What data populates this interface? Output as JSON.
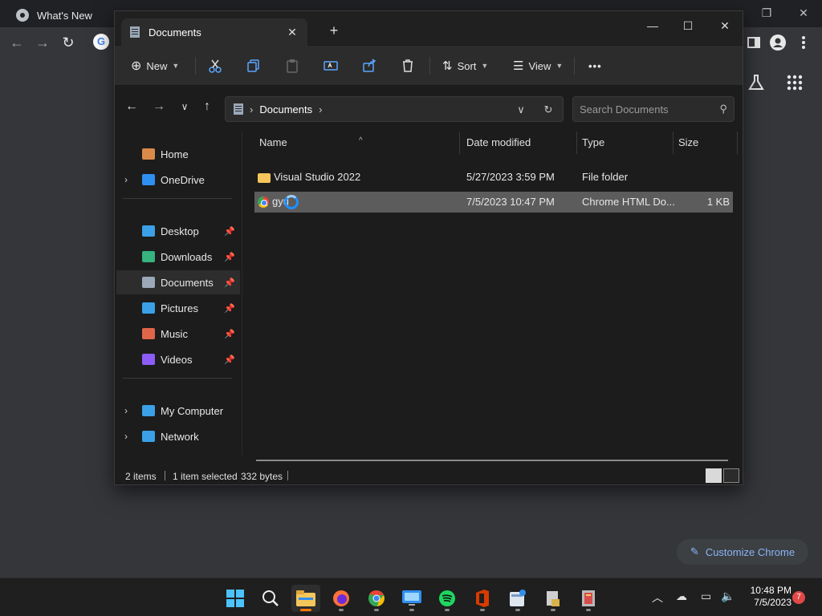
{
  "chrome": {
    "tab_title": "What's New",
    "customize_label": "Customize Chrome"
  },
  "window": {
    "tab_title": "Documents",
    "new_tab_symbol": "+",
    "close_tab_symbol": "✕",
    "minimize_symbol": "—",
    "maximize_symbol": "☐",
    "close_symbol": "✕"
  },
  "toolbar": {
    "new_label": "New",
    "sort_label": "Sort",
    "view_label": "View",
    "more_label": "•••",
    "icons": [
      "cut-icon",
      "copy-icon",
      "paste-icon",
      "rename-icon",
      "share-icon",
      "delete-icon"
    ]
  },
  "address": {
    "crumb": "Documents",
    "search_placeholder": "Search Documents"
  },
  "sidebar": {
    "items": [
      {
        "label": "Home",
        "icon": "home-icon",
        "expandable": false,
        "pinned": false,
        "color": "#d98a4a"
      },
      {
        "label": "OneDrive",
        "icon": "onedrive-icon",
        "expandable": true,
        "pinned": false,
        "color": "#2f8ff0"
      },
      {
        "label": "Desktop",
        "icon": "desktop-icon",
        "expandable": false,
        "pinned": true,
        "color": "#3ba0e6"
      },
      {
        "label": "Downloads",
        "icon": "downloads-icon",
        "expandable": false,
        "pinned": true,
        "color": "#36b37e"
      },
      {
        "label": "Documents",
        "icon": "documents-icon",
        "expandable": false,
        "pinned": true,
        "color": "#9aa8b8",
        "selected": true
      },
      {
        "label": "Pictures",
        "icon": "pictures-icon",
        "expandable": false,
        "pinned": true,
        "color": "#3ba0e6"
      },
      {
        "label": "Music",
        "icon": "music-icon",
        "expandable": false,
        "pinned": true,
        "color": "#e0664a"
      },
      {
        "label": "Videos",
        "icon": "videos-icon",
        "expandable": false,
        "pinned": true,
        "color": "#8b5cf6"
      },
      {
        "label": "My Computer",
        "icon": "computer-icon",
        "expandable": true,
        "pinned": false,
        "color": "#3ba0e6"
      },
      {
        "label": "Network",
        "icon": "network-icon",
        "expandable": true,
        "pinned": false,
        "color": "#3ba0e6"
      }
    ]
  },
  "files": {
    "columns": [
      "Name",
      "Date modified",
      "Type",
      "Size"
    ],
    "rows": [
      {
        "name": "Visual Studio 2022",
        "date": "5/27/2023 3:59 PM",
        "type": "File folder",
        "size": "",
        "icon": "folder-icon"
      },
      {
        "name": "gyu",
        "date": "7/5/2023 10:47 PM",
        "type": "Chrome HTML Do...",
        "size": "1 KB",
        "icon": "chrome-html-icon",
        "selected": true
      }
    ]
  },
  "status": {
    "items": "2 items",
    "selected": "1 item selected",
    "bytes": "332 bytes"
  },
  "taskbar": {
    "time": "10:48 PM",
    "date": "7/5/2023",
    "notification_count": "7",
    "apps": [
      "start-icon",
      "search-icon",
      "file-explorer-icon",
      "firefox-icon",
      "chrome-icon",
      "remote-desktop-icon",
      "spotify-icon",
      "office-icon",
      "calculator-icon",
      "notepad-icon",
      "archive-icon"
    ]
  },
  "colors": {
    "accent": "#1e90ff",
    "selection": "#5c5c5c",
    "window_bg": "#1c1c1c"
  }
}
